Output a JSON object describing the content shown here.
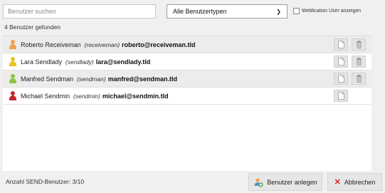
{
  "search": {
    "placeholder": "Benutzer suchen",
    "value": ""
  },
  "type_filter": {
    "selected": "Alle Benutzertypen"
  },
  "weblication_toggle": {
    "label": "Weblication User anzeigen",
    "checked": false
  },
  "result_count": "4 Benutzer gefunden",
  "users": [
    {
      "name": "Roberto Receiveman",
      "login": "(receiveman)",
      "email": "roberto@receiveman.tld",
      "icon": "user-icon",
      "icon_color": "#f0a04a",
      "actions": [
        "document-icon",
        "trash-icon"
      ]
    },
    {
      "name": "Lara Sendlady",
      "login": "(sendlady)",
      "email": "lara@sendlady.tld",
      "icon": "user-icon",
      "icon_color": "#e6c21f",
      "actions": [
        "document-icon",
        "trash-icon"
      ]
    },
    {
      "name": "Manfred Sendman",
      "login": "(sendman)",
      "email": "manfred@sendman.tld",
      "icon": "user-icon",
      "icon_color": "#8cc63f",
      "actions": [
        "document-icon",
        "trash-icon"
      ]
    },
    {
      "name": "Michael Sendmin",
      "login": "(sendmin)",
      "email": "michael@sendmin.tld",
      "icon": "user-icon",
      "icon_color": "#c0282d",
      "actions": [
        "document-icon"
      ]
    }
  ],
  "footer": {
    "send_user_count": "Anzahl SEND-Benutzer: 3/10",
    "create_label": "Benutzer anlegen",
    "cancel_label": "Abbrechen"
  },
  "colors": {
    "cancel_accent": "#e0202a",
    "row_alt": "#ececec",
    "panel_bg": "#f0f0f0"
  }
}
